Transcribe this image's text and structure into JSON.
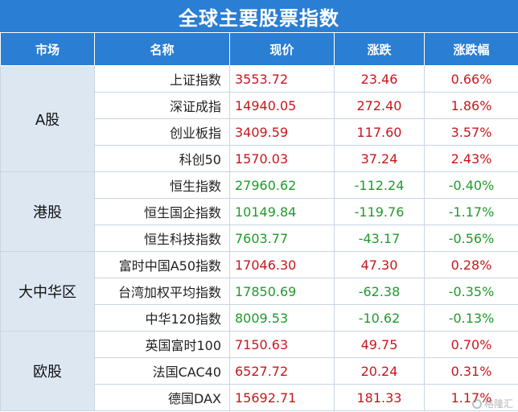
{
  "title": "全球主要股票指数",
  "headers": [
    "市场",
    "名称",
    "现价",
    "涨跌",
    "涨跌幅"
  ],
  "groups": [
    {
      "market": "A股",
      "rows": [
        {
          "name": "上证指数",
          "price": "3553.72",
          "change": "23.46",
          "pct": "0.66%",
          "dir": "up"
        },
        {
          "name": "深证成指",
          "price": "14940.05",
          "change": "272.40",
          "pct": "1.86%",
          "dir": "up"
        },
        {
          "name": "创业板指",
          "price": "3409.59",
          "change": "117.60",
          "pct": "3.57%",
          "dir": "up"
        },
        {
          "name": "科创50",
          "price": "1570.03",
          "change": "37.24",
          "pct": "2.43%",
          "dir": "up"
        }
      ]
    },
    {
      "market": "港股",
      "rows": [
        {
          "name": "恒生指数",
          "price": "27960.62",
          "change": "-112.24",
          "pct": "-0.40%",
          "dir": "down"
        },
        {
          "name": "恒生国企指数",
          "price": "10149.84",
          "change": "-119.76",
          "pct": "-1.17%",
          "dir": "down"
        },
        {
          "name": "恒生科技指数",
          "price": "7603.77",
          "change": "-43.17",
          "pct": "-0.56%",
          "dir": "down"
        }
      ]
    },
    {
      "market": "大中华区",
      "rows": [
        {
          "name": "富时中国A50指数",
          "price": "17046.30",
          "change": "47.30",
          "pct": "0.28%",
          "dir": "up"
        },
        {
          "name": "台湾加权平均指数",
          "price": "17850.69",
          "change": "-62.38",
          "pct": "-0.35%",
          "dir": "down"
        },
        {
          "name": "中华120指数",
          "price": "8009.53",
          "change": "-10.62",
          "pct": "-0.13%",
          "dir": "down"
        }
      ]
    },
    {
      "market": "欧股",
      "rows": [
        {
          "name": "英国富时100",
          "price": "7150.63",
          "change": "49.75",
          "pct": "0.70%",
          "dir": "up"
        },
        {
          "name": "法国CAC40",
          "price": "6527.72",
          "change": "20.24",
          "pct": "0.31%",
          "dir": "up"
        },
        {
          "name": "德国DAX",
          "price": "15692.71",
          "change": "181.33",
          "pct": "1.17%",
          "dir": "up"
        }
      ]
    }
  ],
  "watermark": "格隆汇",
  "colors": {
    "header_bg": "#2a7ed3",
    "market_bg": "#dde7f2",
    "up": "#c8161d",
    "down": "#1f9b2b"
  }
}
